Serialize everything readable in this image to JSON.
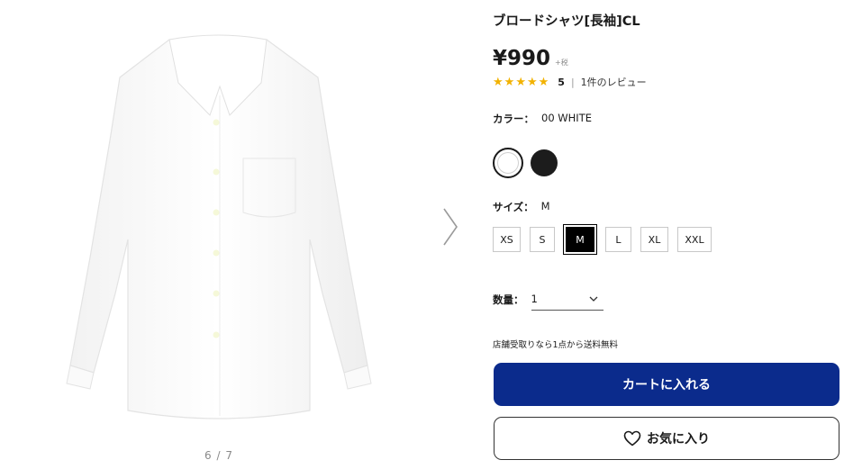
{
  "gallery": {
    "pager": "6 / 7",
    "next_icon": "chevron-right-icon"
  },
  "product": {
    "title": "ブロードシャツ[長袖]CL",
    "price": "¥990",
    "tax_note": "+税",
    "rating": {
      "stars": 5,
      "value": "5",
      "separator": "|",
      "reviews": "1件のレビュー"
    }
  },
  "color": {
    "label": "カラー：",
    "selected": "00 WHITE",
    "swatches": [
      {
        "name": "white",
        "hex": "#ffffff"
      },
      {
        "name": "black",
        "hex": "#1c1c1c"
      }
    ]
  },
  "size": {
    "label": "サイズ：",
    "selected": "M",
    "options": [
      "XS",
      "S",
      "M",
      "L",
      "XL",
      "XXL"
    ]
  },
  "quantity": {
    "label": "数量：",
    "value": "1"
  },
  "pickup_note": "店舗受取りなら1点から送料無料",
  "buttons": {
    "cart": "カートに入れる",
    "favorite": "お気に入り"
  },
  "colors": {
    "primary": "#0b2b8c",
    "star": "#f2b200"
  }
}
